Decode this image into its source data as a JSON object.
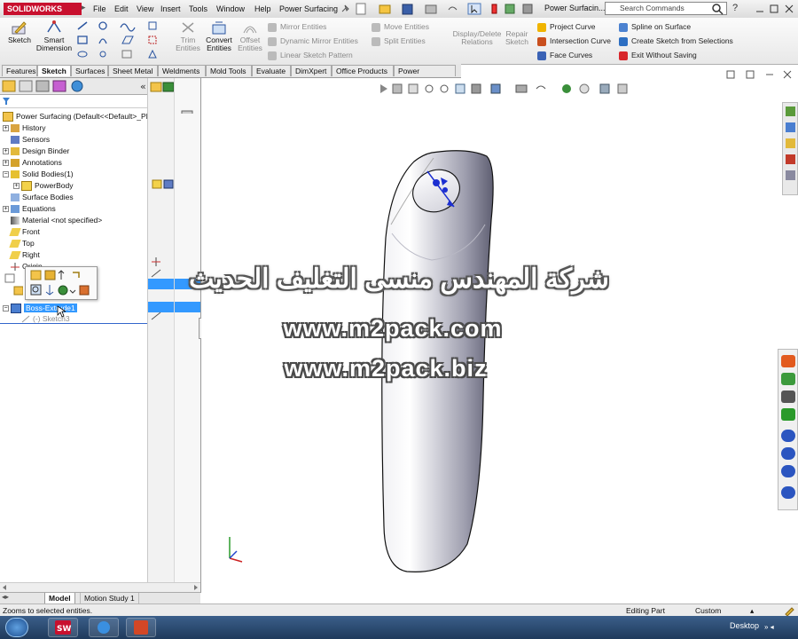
{
  "app": {
    "logo": "SOLIDWORKS",
    "title": "Power Surfacin..."
  },
  "menu": [
    "File",
    "Edit",
    "View",
    "Insert",
    "Tools",
    "Window",
    "Help",
    "Power Surfacing"
  ],
  "search": {
    "placeholder": "Search Commands"
  },
  "commands": {
    "sketch": "Sketch",
    "smart_dim_1": "Smart",
    "smart_dim_2": "Dimension",
    "trim_1": "Trim",
    "trim_2": "Entities",
    "convert_1": "Convert",
    "convert_2": "Entities",
    "offset_1": "Offset",
    "offset_2": "Entities",
    "mirror": "Mirror Entities",
    "dyn_mirror": "Dynamic Mirror Entities",
    "linear_pattern": "Linear Sketch Pattern",
    "move": "Move Entities",
    "split": "Split Entities",
    "display_del_1": "Display/Delete",
    "display_del_2": "Relations",
    "repair_1": "Repair",
    "repair_2": "Sketch",
    "project_curve": "Project Curve",
    "intersection_curve": "Intersection Curve",
    "face_curves": "Face Curves",
    "spline_surface": "Spline on Surface",
    "create_sketch": "Create Sketch from Selections",
    "exit_nosave": "Exit Without Saving"
  },
  "tabs": [
    "Features",
    "Sketch",
    "Surfaces",
    "Sheet Metal",
    "Weldments",
    "Mold Tools",
    "Evaluate",
    "DimXpert",
    "Office Products",
    "Power Surfacing"
  ],
  "active_tab": "Sketch",
  "tree": {
    "root": "Power Surfacing  (Default<<Default>_Ph",
    "items": [
      "History",
      "Sensors",
      "Design Binder",
      "Annotations",
      "Solid Bodies(1)",
      "PowerBody",
      "Surface Bodies",
      "Equations",
      "Material <not specified>",
      "Front",
      "Top",
      "Right",
      "Origin"
    ],
    "selected": "Boss-Extrude1",
    "child": "(-) Sketch3"
  },
  "watermark": {
    "arabic": "شركة المهندس منسى التغليف الحديث",
    "url1": "www.m2pack.com",
    "url2": "www.m2pack.biz"
  },
  "bottom_tabs": [
    "Model",
    "Motion Study 1"
  ],
  "status": {
    "message": "Zooms to selected entities.",
    "mode": "Editing Part",
    "units": "Custom"
  },
  "taskbar": {
    "desktop": "Desktop"
  },
  "colors": {
    "accent": "#c8102e",
    "selection": "#3399ff",
    "taskbar": "#2a4a70"
  }
}
